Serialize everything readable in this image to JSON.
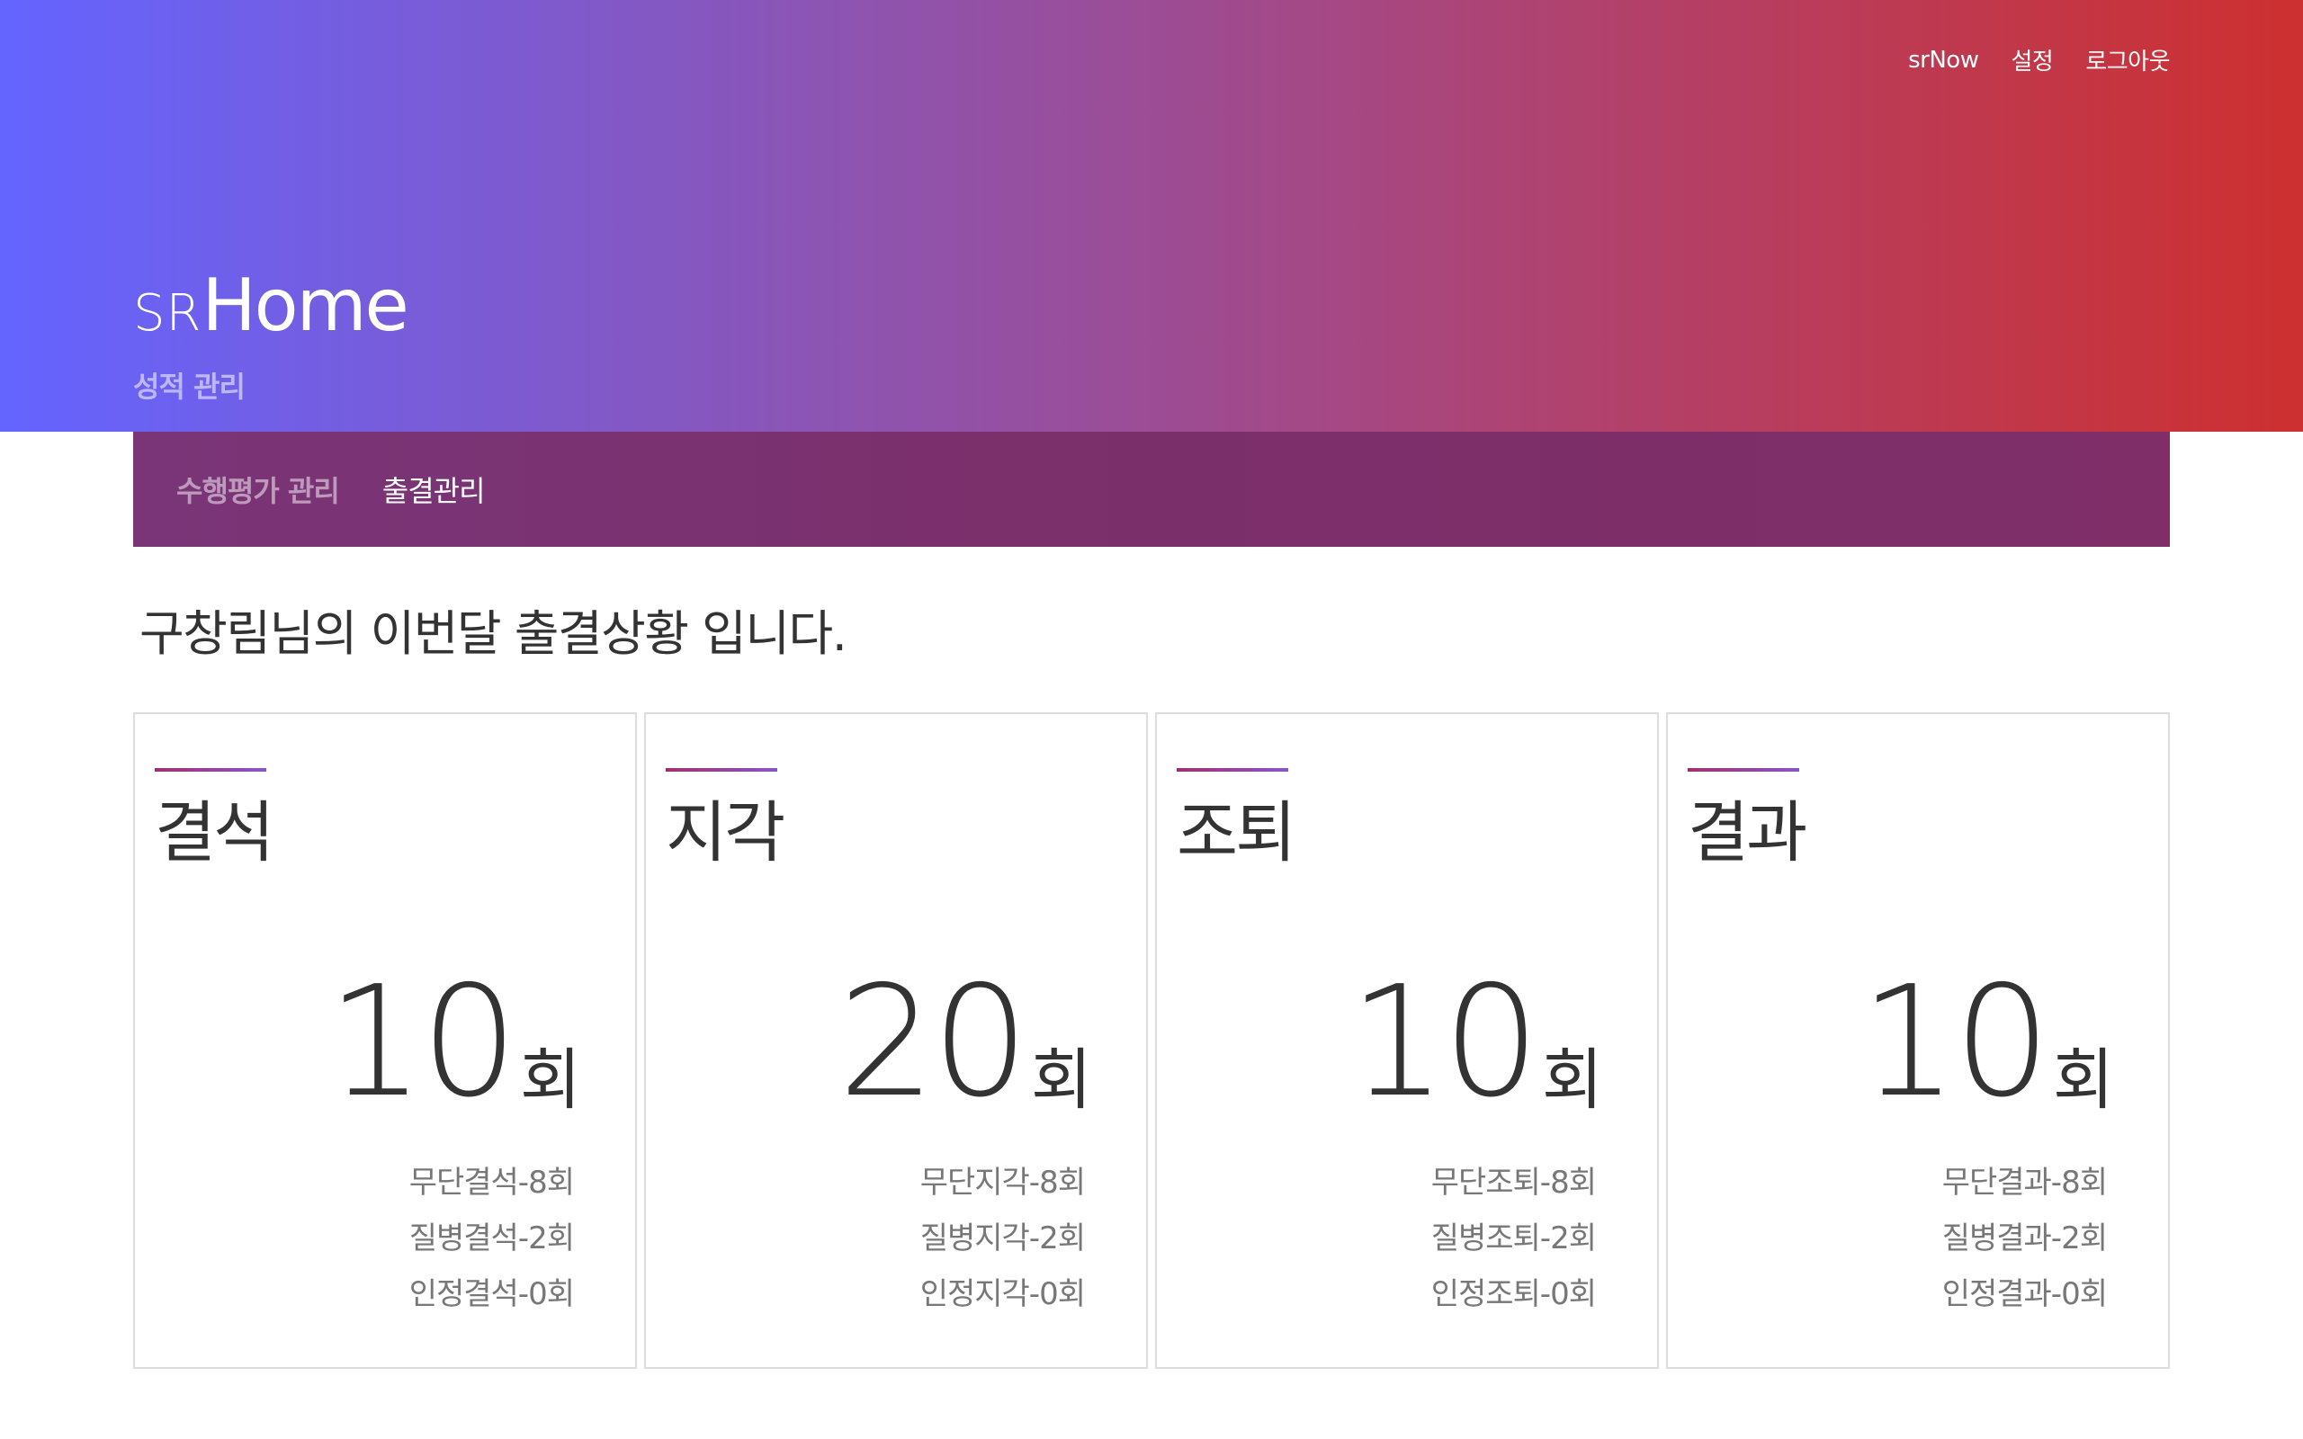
{
  "topnav": {
    "items": [
      {
        "label": "srNow"
      },
      {
        "label": "설정"
      },
      {
        "label": "로그아웃"
      }
    ]
  },
  "brand": {
    "prefix": "SR",
    "name": "Home",
    "subtitle": "성적 관리"
  },
  "subnav": {
    "tabs": [
      {
        "label": "수행평가 관리",
        "active": false
      },
      {
        "label": "출결관리",
        "active": true
      }
    ]
  },
  "main": {
    "greeting": "구창림님의 이번달 출결상황 입니다."
  },
  "cards": [
    {
      "title": "결석",
      "count": "10",
      "unit": "회",
      "details": [
        "무단결석-8회",
        "질병결석-2회",
        "인정결석-0회"
      ]
    },
    {
      "title": "지각",
      "count": "20",
      "unit": "회",
      "details": [
        "무단지각-8회",
        "질병지각-2회",
        "인정지각-0회"
      ]
    },
    {
      "title": "조퇴",
      "count": "10",
      "unit": "회",
      "details": [
        "무단조퇴-8회",
        "질병조퇴-2회",
        "인정조퇴-0회"
      ]
    },
    {
      "title": "결과",
      "count": "10",
      "unit": "회",
      "details": [
        "무단결과-8회",
        "질병결과-2회",
        "인정결과-0회"
      ]
    }
  ],
  "colors": {
    "hero_gradient_start": "#6464ff",
    "hero_gradient_end": "#cd3030",
    "subnav_bg": "#7b2f6a",
    "accent_line_start": "#a03070",
    "accent_line_end": "#8a55c8"
  }
}
